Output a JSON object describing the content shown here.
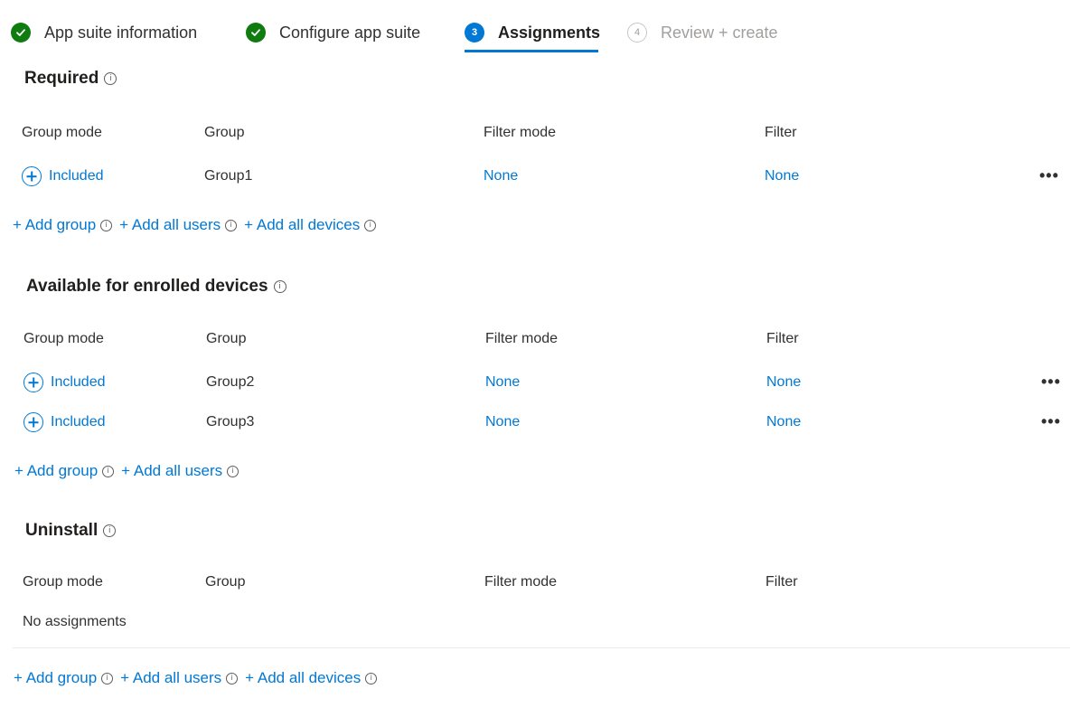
{
  "wizard": {
    "steps": [
      {
        "label": "App suite information",
        "status": "done"
      },
      {
        "label": "Configure app suite",
        "status": "done"
      },
      {
        "label": "Assignments",
        "status": "current",
        "number": "3"
      },
      {
        "label": "Review + create",
        "status": "future",
        "number": "4"
      }
    ]
  },
  "columns": {
    "group_mode": "Group mode",
    "group": "Group",
    "filter_mode": "Filter mode",
    "filter": "Filter"
  },
  "sections": {
    "required": {
      "title": "Required",
      "rows": [
        {
          "mode": "Included",
          "group": "Group1",
          "filter_mode": "None",
          "filter": "None"
        }
      ],
      "actions": [
        "+ Add group",
        "+ Add all users",
        "+ Add all devices"
      ]
    },
    "available": {
      "title": "Available for enrolled devices",
      "rows": [
        {
          "mode": "Included",
          "group": "Group2",
          "filter_mode": "None",
          "filter": "None"
        },
        {
          "mode": "Included",
          "group": "Group3",
          "filter_mode": "None",
          "filter": "None"
        }
      ],
      "actions": [
        "+ Add group",
        "+ Add all users"
      ]
    },
    "uninstall": {
      "title": "Uninstall",
      "empty_text": "No assignments",
      "actions": [
        "+ Add group",
        "+ Add all users",
        "+ Add all devices"
      ]
    }
  },
  "more_label": "•••",
  "colors": {
    "accent": "#0078d4",
    "success": "#107c10",
    "muted": "#a19f9d"
  }
}
